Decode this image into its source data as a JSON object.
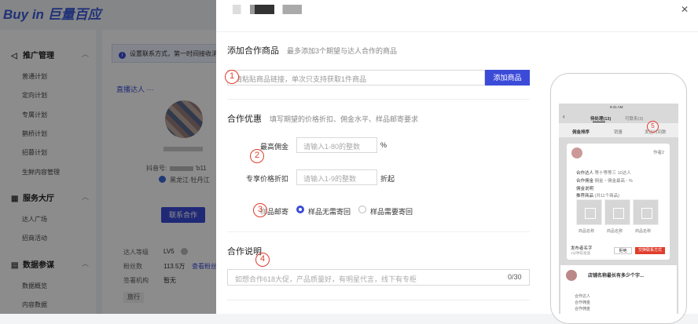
{
  "app": {
    "logo": "Buy in 巨量百应"
  },
  "sidebar": {
    "groups": [
      {
        "label": "推广管理",
        "icon": "megaphone-icon"
      },
      {
        "label": "服务大厅",
        "icon": "grid-icon"
      },
      {
        "label": "数据参谋",
        "icon": "chart-icon"
      }
    ],
    "items": {
      "g1": [
        "普通计划",
        "定向计划",
        "专属计划",
        "鹊桥计划",
        "招募计划",
        "生鲜内容管理"
      ],
      "g2": [
        "达人广场",
        "招商活动"
      ],
      "g3": [
        "数据概览",
        "内容数据"
      ]
    }
  },
  "background": {
    "notice": "设置联系方式，第一时间接收消息",
    "live_tab": "直播达人",
    "douyin_label": "抖音号:",
    "douyin_suffix": "'b11",
    "location": "黑龙江·牡丹江",
    "contact_button": "联系合作",
    "stats": [
      {
        "label": "达人等级",
        "value": "LV5"
      },
      {
        "label": "粉丝数",
        "value": "113.5万"
      },
      {
        "label": "签署机构",
        "value": "暂无"
      }
    ],
    "fans_link": "查看粉丝",
    "tag": "旅行"
  },
  "drawer": {
    "close_icon": "close-icon",
    "add_product": {
      "title": "添加合作商品",
      "hint": "最多添加3个期望与达人合作的商品",
      "placeholder": "请粘贴商品链接，单次只支持获取1件商品",
      "button": "添加商品"
    },
    "offer": {
      "title": "合作优惠",
      "hint": "填写期望的价格折扣、佣金水平、样品邮寄要求",
      "commission": {
        "label": "最高佣金",
        "placeholder": "请输入1-80的整数",
        "unit": "%"
      },
      "discount": {
        "label": "专享价格折扣",
        "placeholder": "请输入1-9的整数",
        "unit": "折起"
      },
      "sample": {
        "label": "样品邮寄",
        "options": [
          {
            "label": "样品无需寄回",
            "checked": true
          },
          {
            "label": "样品需要寄回",
            "checked": false
          }
        ]
      }
    },
    "description": {
      "title": "合作说明",
      "placeholder": "如想合作618大促，产品质量好，有明星代言，线下有专柜",
      "counter": "0/30"
    },
    "markers": [
      "1",
      "2",
      "3",
      "4"
    ]
  },
  "phone": {
    "time": "9:41 AM",
    "tabs": [
      "待处理(13)",
      "可联系(3)"
    ],
    "subtabs": [
      "佣金排序",
      "销量",
      "发送时间数"
    ],
    "marker": "5",
    "card": {
      "badge": "作者2",
      "rows": [
        {
          "label": "合作达人",
          "value": "等十等等三 10达人"
        },
        {
          "label": "合作佣金",
          "value": "佣金・佣金最高 - %"
        },
        {
          "label": "佣金说明",
          "value": ""
        },
        {
          "label": "推荐商品",
          "value": "(共11个商品)"
        }
      ],
      "products": [
        "商品名称",
        "商品名称",
        "商品名称"
      ],
      "footer_title": "发布者名字",
      "footer_sub": "1分钟前发送",
      "btn_decline": "拒绝",
      "btn_exchange": "交换联系方式"
    },
    "card2": {
      "title": "店铺名称最长有多少个字...",
      "rows": [
        "合作达人",
        "合作佣金",
        "合作佣金"
      ]
    }
  }
}
